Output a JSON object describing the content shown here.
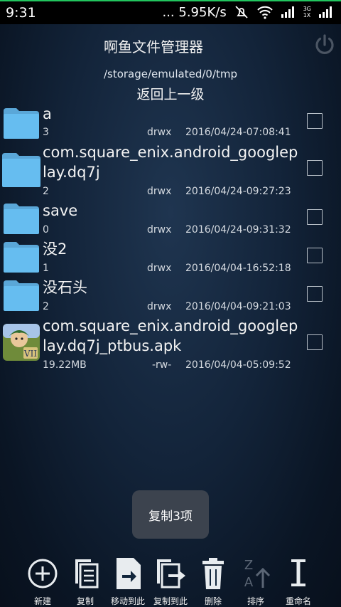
{
  "status_bar": {
    "time": "9:31",
    "network_speed": "... 5.95K/s",
    "signal_label_top": "3G",
    "signal_label_bottom": "1X"
  },
  "header": {
    "title": "啊鱼文件管理器",
    "path": "/storage/emulated/0/tmp",
    "up_level": "返回上一级"
  },
  "files": [
    {
      "name": "a",
      "count": "3",
      "perm": "drwx",
      "date": "2016/04/24-07:08:41",
      "type": "folder"
    },
    {
      "name": "com.square_enix.android_googleplay.dq7j",
      "count": "2",
      "perm": "drwx",
      "date": "2016/04/24-09:27:23",
      "type": "folder"
    },
    {
      "name": "save",
      "count": "0",
      "perm": "drwx",
      "date": "2016/04/24-09:31:32",
      "type": "folder"
    },
    {
      "name": "没2",
      "count": "1",
      "perm": "drwx",
      "date": "2016/04/04-16:52:18",
      "type": "folder"
    },
    {
      "name": "没石头",
      "count": "2",
      "perm": "drwx",
      "date": "2016/04/04-09:21:03",
      "type": "folder"
    },
    {
      "name": "com.square_enix.android_googleplay.dq7j_ptbus.apk",
      "count": "19.22MB",
      "perm": "-rw-",
      "date": "2016/04/04-05:09:52",
      "type": "apk"
    }
  ],
  "toast": {
    "text": "复制3项"
  },
  "toolbar": {
    "new": "新建",
    "copy": "复制",
    "move_here": "移动到此",
    "copy_here": "复制到此",
    "delete": "删除",
    "sort": "排序",
    "rename": "重命名"
  },
  "colors": {
    "folder": "#62b8ee",
    "status_accent": "#22c55e",
    "toolbar_icon": "#e8ecef"
  }
}
